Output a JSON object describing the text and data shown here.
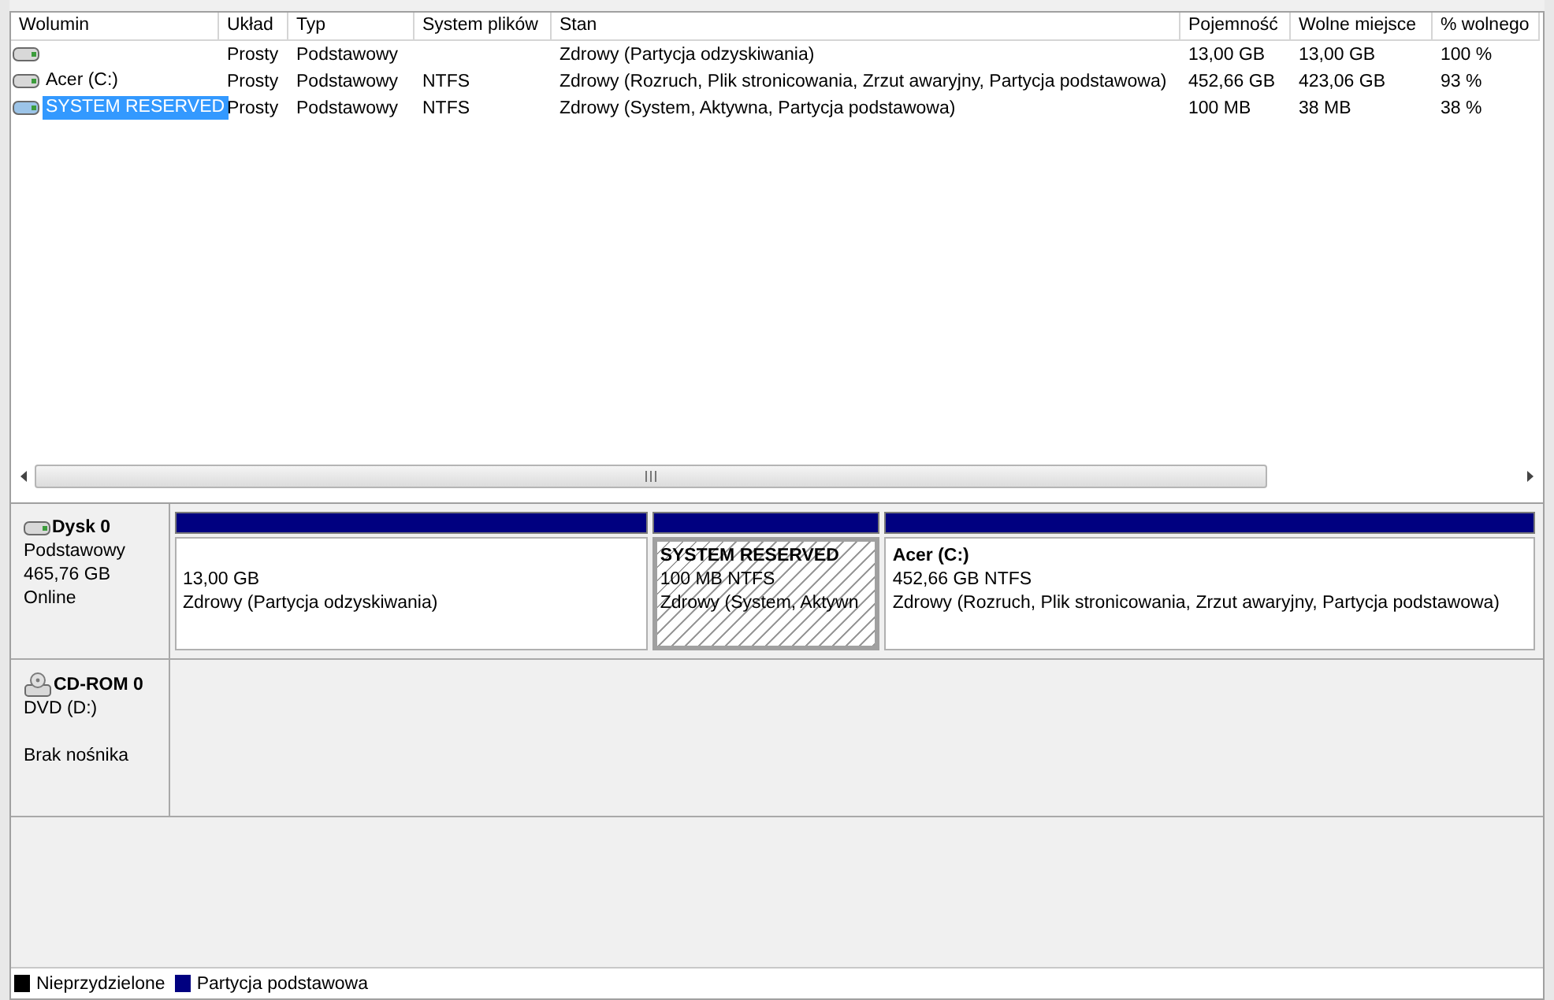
{
  "volumes": {
    "columns": [
      "Wolumin",
      "Układ",
      "Typ",
      "System plików",
      "Stan",
      "Pojemność",
      "Wolne miejsce",
      "% wolnego"
    ],
    "rows": [
      {
        "cells": [
          "",
          "Prosty",
          "Podstawowy",
          "",
          "Zdrowy (Partycja odzyskiwania)",
          "13,00 GB",
          "13,00 GB",
          "100 %"
        ],
        "selected": false
      },
      {
        "cells": [
          "Acer (C:)",
          "Prosty",
          "Podstawowy",
          "NTFS",
          "Zdrowy (Rozruch, Plik stronicowania, Zrzut awaryjny, Partycja podstawowa)",
          "452,66 GB",
          "423,06 GB",
          "93 %"
        ],
        "selected": false
      },
      {
        "cells": [
          "SYSTEM RESERVED",
          "Prosty",
          "Podstawowy",
          "NTFS",
          "Zdrowy (System, Aktywna, Partycja podstawowa)",
          "100 MB",
          "38 MB",
          "38 %"
        ],
        "selected": true
      }
    ]
  },
  "disks": [
    {
      "kind": "disk",
      "name": "Dysk 0",
      "lines": [
        "Podstawowy",
        "465,76 GB",
        "Online"
      ],
      "partitions": [
        {
          "size": "13,00 GB",
          "status": "Zdrowy (Partycja odzyskiwania)",
          "selected": false
        },
        {
          "name": "SYSTEM RESERVED",
          "size": "100 MB NTFS",
          "status": "Zdrowy (System, Aktywn",
          "selected": true
        },
        {
          "name": "Acer  (C:)",
          "size": "452,66 GB NTFS",
          "status": "Zdrowy (Rozruch, Plik stronicowania, Zrzut awaryjny, Partycja podstawowa)",
          "selected": false
        }
      ]
    },
    {
      "kind": "cdrom",
      "name": "CD-ROM 0",
      "lines": [
        "DVD (D:)"
      ],
      "status": "Brak nośnika"
    }
  ],
  "legend": [
    {
      "label": "Nieprzydzielone",
      "color": "#000000"
    },
    {
      "label": "Partycja podstawowa",
      "color": "#000080"
    }
  ]
}
